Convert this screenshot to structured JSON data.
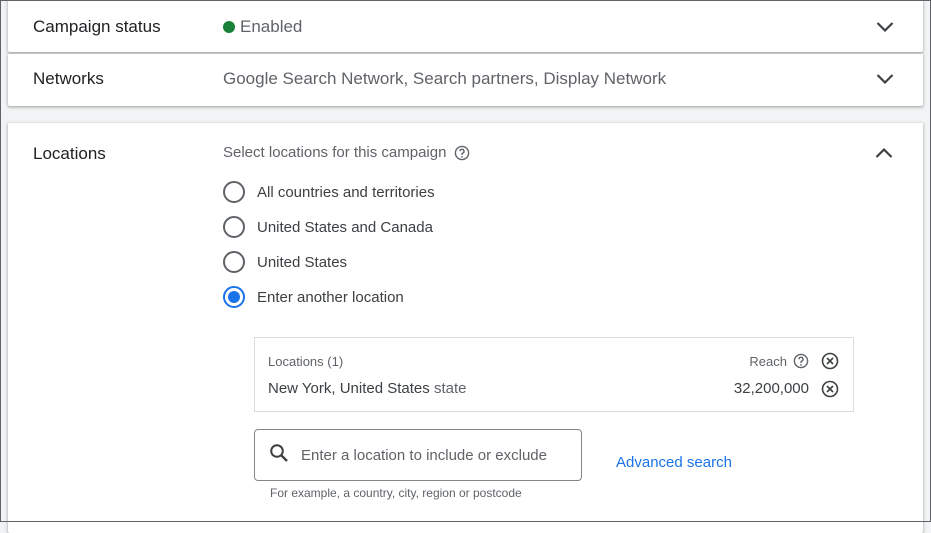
{
  "campaign_status": {
    "title": "Campaign status",
    "value": "Enabled",
    "status_color": "#188038",
    "icon": "chevron-down-icon"
  },
  "networks": {
    "title": "Networks",
    "value": "Google Search Network, Search partners, Display Network",
    "icon": "chevron-down-icon"
  },
  "locations": {
    "title": "Locations",
    "subtitle": "Select locations for this campaign",
    "help_icon": "help-icon",
    "collapse_icon": "chevron-up-icon",
    "options": [
      {
        "label": "All countries and territories",
        "selected": false
      },
      {
        "label": "United States and Canada",
        "selected": false
      },
      {
        "label": "United States",
        "selected": false
      },
      {
        "label": "Enter another location",
        "selected": true
      }
    ],
    "selected_box": {
      "header": "Locations (1)",
      "reach_label": "Reach",
      "items": [
        {
          "name": "New York, United States",
          "type": "state",
          "reach": "32,200,000"
        }
      ]
    },
    "search": {
      "placeholder": "Enter a location to include or exclude",
      "value": ""
    },
    "advanced_search": "Advanced search",
    "hint": "For example, a country, city, region or postcode",
    "accent_color": "#1a73e8"
  }
}
